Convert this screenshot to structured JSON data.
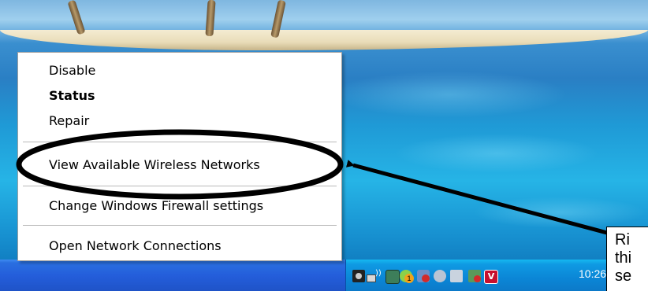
{
  "context_menu": {
    "items": [
      {
        "label": "Disable"
      },
      {
        "label": "Status"
      },
      {
        "label": "Repair"
      },
      {
        "label": "View Available Wireless Networks"
      },
      {
        "label": "Change Windows Firewall settings"
      },
      {
        "label": "Open Network Connections"
      }
    ],
    "default_item": "Status"
  },
  "taskbar": {
    "clock": "10:26",
    "tray_icons": [
      "camera-icon",
      "wireless-network-icon",
      "display-icon",
      "notification-badge-icon",
      "security-alert-icon",
      "volume-icon",
      "usb-device-icon",
      "network-warning-icon",
      "antivirus-shield-icon"
    ],
    "tray_badge_count": "1"
  },
  "callout": {
    "lines": [
      "Ri",
      "thi",
      "se"
    ]
  },
  "colors": {
    "taskbar_blue": "#245edb",
    "tray_blue": "#0b86d6",
    "annotation_black": "#000000"
  }
}
